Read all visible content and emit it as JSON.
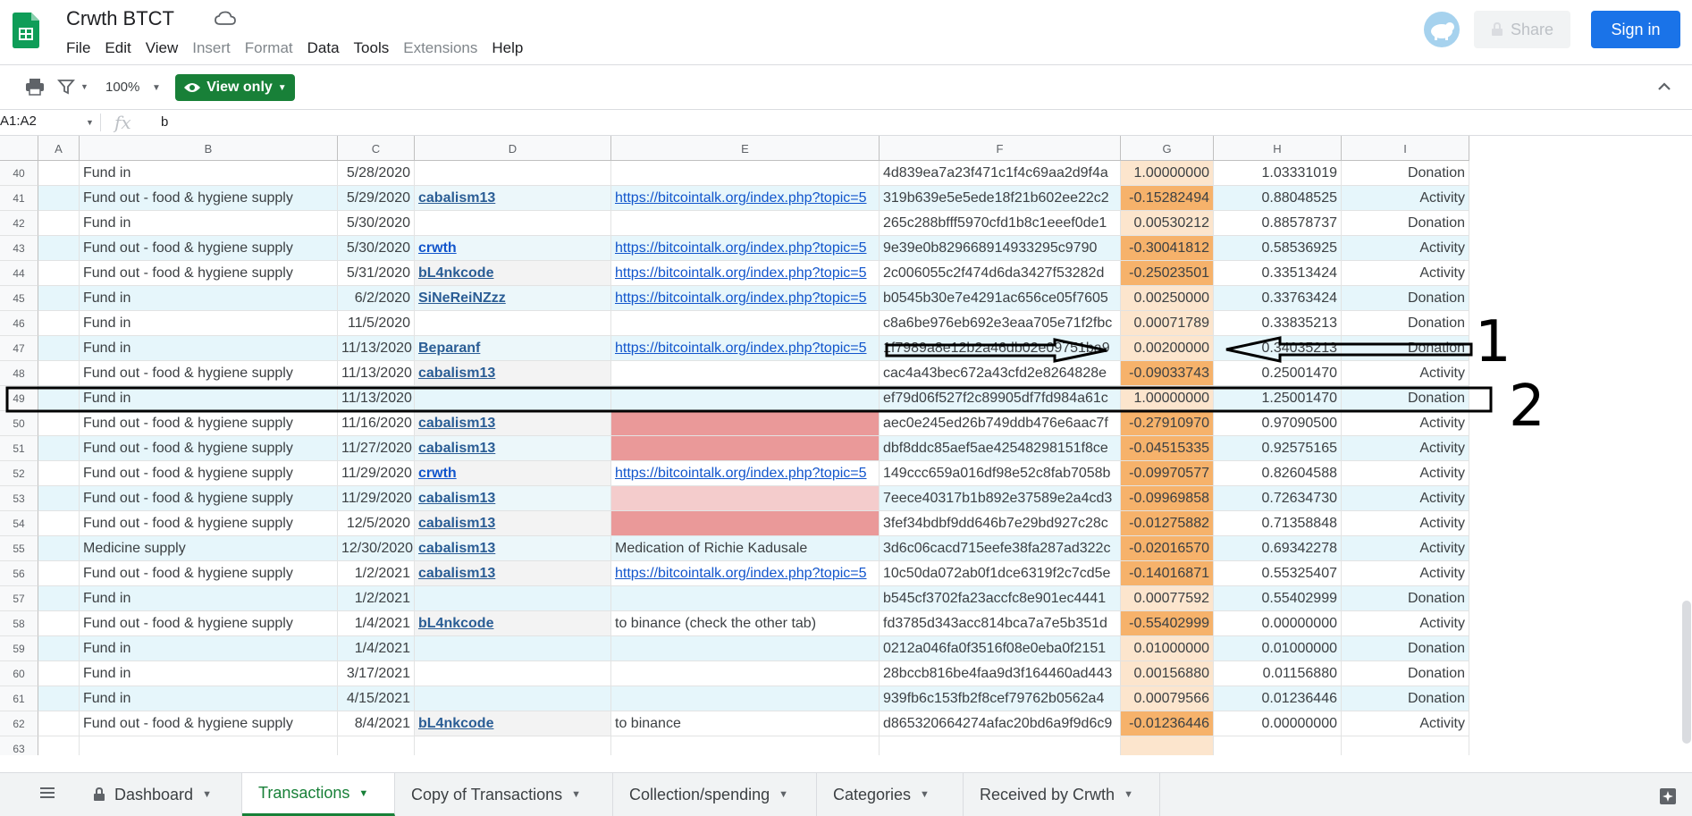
{
  "header": {
    "title": "Crwth BTCT",
    "menu": [
      "File",
      "Edit",
      "View",
      "Insert",
      "Format",
      "Data",
      "Tools",
      "Extensions",
      "Help"
    ],
    "menu_disabled": [
      "Insert",
      "Format",
      "Extensions"
    ],
    "share_label": "Share",
    "signin_label": "Sign in"
  },
  "toolbar": {
    "zoom": "100%",
    "view_only_label": "View only"
  },
  "formula_bar": {
    "name_box": "A1:A2",
    "fx": "fx",
    "value": "b"
  },
  "columns": [
    "A",
    "B",
    "C",
    "D",
    "E",
    "F",
    "G",
    "H",
    "I"
  ],
  "rows": [
    {
      "n": "40",
      "b": "Fund in",
      "c": "5/28/2020",
      "d": "",
      "e": "",
      "f": "4d839ea7a23f471c1f4c69aa2d9f4a",
      "g": "1.00000000",
      "h": "1.03331019",
      "i": "Donation",
      "band": false,
      "gneg": false
    },
    {
      "n": "41",
      "b": "Fund out - food & hygiene supply",
      "c": "5/29/2020",
      "d": "cabalism13",
      "e": "https://bitcointalk.org/index.php?topic=5",
      "f": "319b639e5e5ede18f21b602ee22c2",
      "g": "-0.15282494",
      "h": "0.88048525",
      "i": "Activity",
      "band": true,
      "gneg": true
    },
    {
      "n": "42",
      "b": "Fund in",
      "c": "5/30/2020",
      "d": "",
      "e": "",
      "f": "265c288bfff5970cfd1b8c1eeef0de1",
      "g": "0.00530212",
      "h": "0.88578737",
      "i": "Donation",
      "band": false,
      "gneg": false
    },
    {
      "n": "43",
      "b": "Fund out - food & hygiene supply",
      "c": "5/30/2020",
      "d": "crwth",
      "e": "https://bitcointalk.org/index.php?topic=5",
      "f": "9e39e0b829668914933295c9790",
      "g": "-0.30041812",
      "h": "0.58536925",
      "i": "Activity",
      "band": true,
      "gneg": true
    },
    {
      "n": "44",
      "b": "Fund out - food & hygiene supply",
      "c": "5/31/2020",
      "d": "bL4nkcode",
      "e": "https://bitcointalk.org/index.php?topic=5",
      "f": "2c006055c2f474d6da3427f53282d",
      "g": "-0.25023501",
      "h": "0.33513424",
      "i": "Activity",
      "band": false,
      "gneg": true
    },
    {
      "n": "45",
      "b": "Fund in",
      "c": "6/2/2020",
      "d": "SiNeReiNZzz",
      "e": "https://bitcointalk.org/index.php?topic=5",
      "f": "b0545b30e7e4291ac656ce05f7605",
      "g": "0.00250000",
      "h": "0.33763424",
      "i": "Donation",
      "band": true,
      "gneg": false
    },
    {
      "n": "46",
      "b": "Fund in",
      "c": "11/5/2020",
      "d": "",
      "e": "",
      "f": "c8a6be976eb692e3eaa705e71f2fbc",
      "g": "0.00071789",
      "h": "0.33835213",
      "i": "Donation",
      "band": false,
      "gneg": false
    },
    {
      "n": "47",
      "b": "Fund in",
      "c": "11/13/2020",
      "d": "Beparanf",
      "e": "https://bitcointalk.org/index.php?topic=5",
      "f": "1f7989a8e12b2a46db02e09751ba9",
      "g": "0.00200000",
      "h": "0.34035213",
      "i": "Donation",
      "band": true,
      "gneg": false
    },
    {
      "n": "48",
      "b": "Fund out - food & hygiene supply",
      "c": "11/13/2020",
      "d": "cabalism13",
      "e": "",
      "f": "cac4a43bec672a43cfd2e8264828e",
      "g": "-0.09033743",
      "h": "0.25001470",
      "i": "Activity",
      "band": false,
      "gneg": true
    },
    {
      "n": "49",
      "b": "Fund in",
      "c": "11/13/2020",
      "d": "",
      "e": "",
      "f": "ef79d06f527f2c89905df7fd984a61c",
      "g": "1.00000000",
      "h": "1.25001470",
      "i": "Donation",
      "band": true,
      "gneg": false
    },
    {
      "n": "50",
      "b": "Fund out - food & hygiene supply",
      "c": "11/16/2020",
      "d": "cabalism13",
      "e": "",
      "f": "aec0e245ed26b749ddb476e6aac7f",
      "g": "-0.27910970",
      "h": "0.97090500",
      "i": "Activity",
      "band": false,
      "gneg": true,
      "ered": "dark"
    },
    {
      "n": "51",
      "b": "Fund out - food & hygiene supply",
      "c": "11/27/2020",
      "d": "cabalism13",
      "e": "",
      "f": "dbf8ddc85aef5ae42548298151f8ce",
      "g": "-0.04515335",
      "h": "0.92575165",
      "i": "Activity",
      "band": true,
      "gneg": true,
      "ered": "dark"
    },
    {
      "n": "52",
      "b": "Fund out - food & hygiene supply",
      "c": "11/29/2020",
      "d": "crwth",
      "e": "https://bitcointalk.org/index.php?topic=5",
      "f": "149ccc659a016df98e52c8fab7058b",
      "g": "-0.09970577",
      "h": "0.82604588",
      "i": "Activity",
      "band": false,
      "gneg": true
    },
    {
      "n": "53",
      "b": "Fund out - food & hygiene supply",
      "c": "11/29/2020",
      "d": "cabalism13",
      "e": "",
      "f": "7eece40317b1b892e37589e2a4cd3",
      "g": "-0.09969858",
      "h": "0.72634730",
      "i": "Activity",
      "band": true,
      "gneg": true,
      "ered": "light"
    },
    {
      "n": "54",
      "b": "Fund out - food & hygiene supply",
      "c": "12/5/2020",
      "d": "cabalism13",
      "e": "",
      "f": "3fef34bdbf9dd646b7e29bd927c28c",
      "g": "-0.01275882",
      "h": "0.71358848",
      "i": "Activity",
      "band": false,
      "gneg": true,
      "ered": "dark"
    },
    {
      "n": "55",
      "b": "Medicine supply",
      "c": "12/30/2020",
      "d": "cabalism13",
      "e": "Medication of Richie Kadusale",
      "f": "3d6c06cacd715eefe38fa287ad322c",
      "g": "-0.02016570",
      "h": "0.69342278",
      "i": "Activity",
      "band": true,
      "gneg": true,
      "eplain": true
    },
    {
      "n": "56",
      "b": "Fund out - food & hygiene supply",
      "c": "1/2/2021",
      "d": "cabalism13",
      "e": "https://bitcointalk.org/index.php?topic=5",
      "f": "10c50da072ab0f1dce6319f2c7cd5e",
      "g": "-0.14016871",
      "h": "0.55325407",
      "i": "Activity",
      "band": false,
      "gneg": true
    },
    {
      "n": "57",
      "b": "Fund in",
      "c": "1/2/2021",
      "d": "",
      "e": "",
      "f": "b545cf3702fa23accfc8e901ec4441",
      "g": "0.00077592",
      "h": "0.55402999",
      "i": "Donation",
      "band": true,
      "gneg": false
    },
    {
      "n": "58",
      "b": "Fund out - food & hygiene supply",
      "c": "1/4/2021",
      "d": "bL4nkcode",
      "e": "to binance (check the other tab)",
      "f": "fd3785d343acc814bca7a7e5b351d",
      "g": "-0.55402999",
      "h": "0.00000000",
      "i": "Activity",
      "band": false,
      "gneg": true,
      "eplain": true
    },
    {
      "n": "59",
      "b": "Fund in",
      "c": "1/4/2021",
      "d": "",
      "e": "",
      "f": "0212a046fa0f3516f08e0eba0f2151",
      "g": "0.01000000",
      "h": "0.01000000",
      "i": "Donation",
      "band": true,
      "gneg": false
    },
    {
      "n": "60",
      "b": "Fund in",
      "c": "3/17/2021",
      "d": "",
      "e": "",
      "f": "28bccb816be4faa9d3f164460ad443",
      "g": "0.00156880",
      "h": "0.01156880",
      "i": "Donation",
      "band": false,
      "gneg": false
    },
    {
      "n": "61",
      "b": "Fund in",
      "c": "4/15/2021",
      "d": "",
      "e": "",
      "f": "939fb6c153fb2f8cef79762b0562a4",
      "g": "0.00079566",
      "h": "0.01236446",
      "i": "Donation",
      "band": true,
      "gneg": false
    },
    {
      "n": "62",
      "b": "Fund out - food & hygiene supply",
      "c": "8/4/2021",
      "d": "bL4nkcode",
      "e": "to binance",
      "f": "d865320664274afac20bd6a9f9d6c9",
      "g": "-0.01236446",
      "h": "0.00000000",
      "i": "Activity",
      "band": false,
      "gneg": true,
      "eplain": true
    },
    {
      "n": "63",
      "b": "",
      "c": "",
      "d": "",
      "e": "",
      "f": "",
      "g": "",
      "h": "",
      "i": "",
      "band": false,
      "gneg": false,
      "empty": true
    }
  ],
  "annotations": {
    "label_1": "1",
    "label_2": "2"
  },
  "tabs": [
    {
      "label": "Dashboard",
      "locked": true
    },
    {
      "label": "Transactions",
      "active": true
    },
    {
      "label": "Copy of Transactions"
    },
    {
      "label": "Collection/spending"
    },
    {
      "label": "Categories"
    },
    {
      "label": "Received by Crwth"
    }
  ],
  "colors": {
    "green": "#188038",
    "blue": "#1a73e8",
    "band": "#e6f6fb",
    "neg_fill": "#f6b26b",
    "pos_fill": "#fce5cd",
    "red_dark": "#ea9999",
    "red_light": "#f4cccc"
  }
}
